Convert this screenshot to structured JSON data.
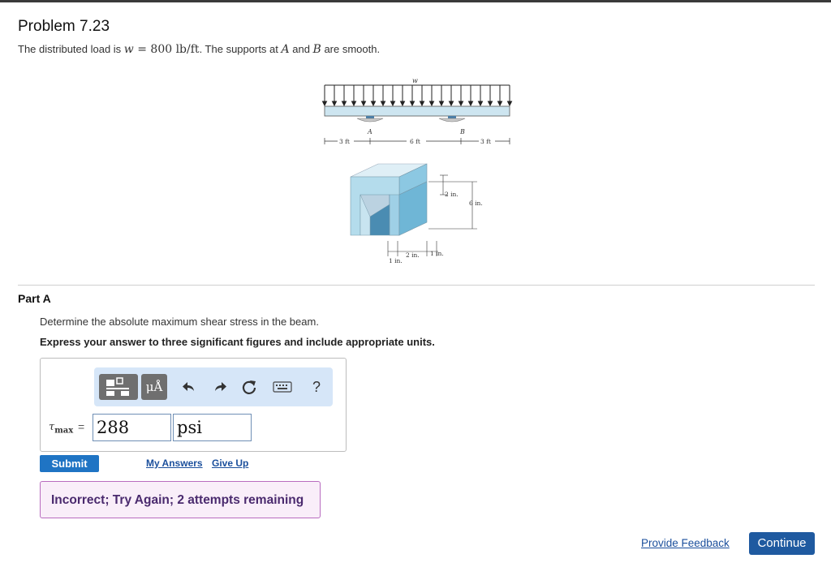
{
  "problem": {
    "title": "Problem 7.23",
    "statement_pre": "The distributed load is ",
    "statement_w": "w",
    "statement_eq": " = 800 lb/ft",
    "statement_mid": ". The supports at ",
    "statement_a": "A",
    "statement_and": " and ",
    "statement_b": "B",
    "statement_post": " are smooth."
  },
  "figure": {
    "load_label": "w",
    "support_a": "A",
    "support_b": "B",
    "dim_left": "3 ft",
    "dim_mid": "6 ft",
    "dim_right": "3 ft",
    "dim_top_flange": "2 in.",
    "dim_height": "6 in.",
    "dim_bottom_1": "1 in.",
    "dim_bottom_2": "2 in.",
    "dim_bottom_3": "1 in."
  },
  "part": {
    "label": "Part A",
    "question": "Determine the absolute maximum shear stress in the beam.",
    "instruction": "Express your answer to three significant figures and include appropriate units."
  },
  "toolbar": {
    "units_label": "μÅ",
    "help_label": "?"
  },
  "answer": {
    "var_symbol": "τ",
    "var_sub": "max",
    "equals": "=",
    "value": "288",
    "unit": "psi"
  },
  "actions": {
    "submit": "Submit",
    "my_answers": "My Answers",
    "give_up": "Give Up",
    "provide_feedback": "Provide Feedback",
    "continue": "Continue"
  },
  "feedback": {
    "message": "Incorrect; Try Again; 2 attempts remaining"
  },
  "colors": {
    "beam": "#cde5f0",
    "section": "#9fd0e6",
    "primary": "#1f74c4",
    "feedback_bg": "#f9eef9",
    "feedback_border": "#b86cbf"
  }
}
